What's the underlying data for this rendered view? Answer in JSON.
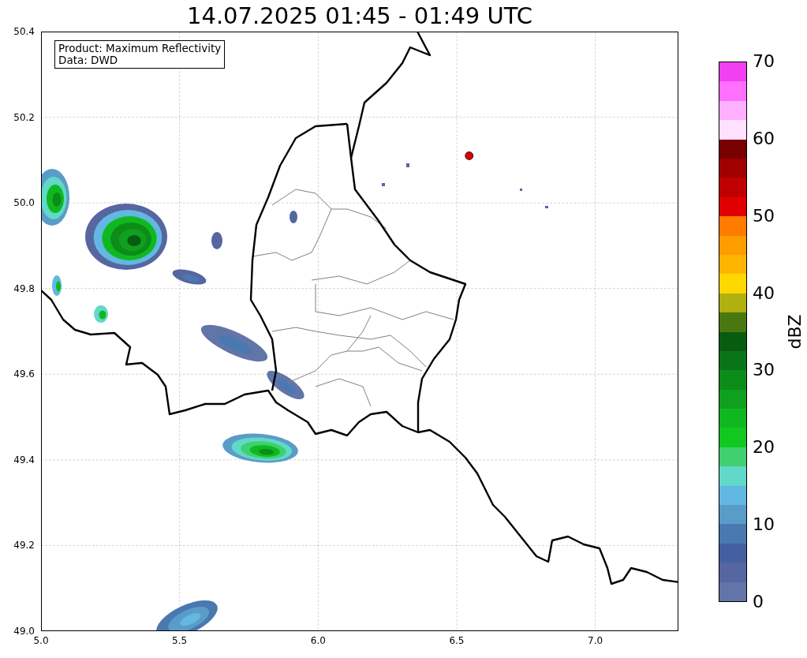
{
  "title": "14.07.2025 01:45 - 01:49 UTC",
  "info_box": {
    "lines": [
      "Product: Maximum Reflectivity",
      "Data: DWD"
    ]
  },
  "map": {
    "xticks": [
      "5.0",
      "5.5",
      "6.0",
      "6.5",
      "7.0"
    ],
    "yticks": [
      "50.4",
      "50.2",
      "50.0",
      "49.8",
      "49.6",
      "49.4",
      "49.2",
      "49.0"
    ]
  },
  "colorbar": {
    "label": "dBZ",
    "ticks": [
      "70",
      "60",
      "50",
      "40",
      "30",
      "20",
      "10",
      "0"
    ],
    "segments": [
      {
        "color": "#6275a8"
      },
      {
        "color": "#5566a0"
      },
      {
        "color": "#4560a0"
      },
      {
        "color": "#4a78b0"
      },
      {
        "color": "#5a9cc8"
      },
      {
        "color": "#62b8e0"
      },
      {
        "color": "#62d8c8"
      },
      {
        "color": "#40d070"
      },
      {
        "color": "#10c820"
      },
      {
        "color": "#10b820"
      },
      {
        "color": "#10a020"
      },
      {
        "color": "#0c8c18"
      },
      {
        "color": "#0a7418"
      },
      {
        "color": "#085c10"
      },
      {
        "color": "#4a7810"
      },
      {
        "color": "#b0b010"
      },
      {
        "color": "#ffd800"
      },
      {
        "color": "#ffb400"
      },
      {
        "color": "#ff9c00"
      },
      {
        "color": "#ff7c00"
      },
      {
        "color": "#e00000"
      },
      {
        "color": "#c00000"
      },
      {
        "color": "#a00000"
      },
      {
        "color": "#780000"
      },
      {
        "color": "#ffe0ff"
      },
      {
        "color": "#ffb0ff"
      },
      {
        "color": "#ff70ff"
      },
      {
        "color": "#f040f0"
      }
    ]
  }
}
